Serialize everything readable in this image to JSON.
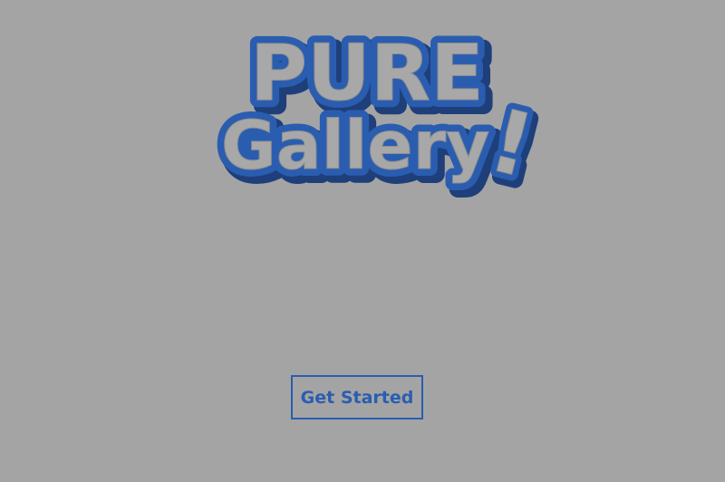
{
  "logo": {
    "line1": "PURE",
    "line2": "Gallery",
    "mark": "!"
  },
  "actions": {
    "get_started_label": "Get Started"
  },
  "colors": {
    "background": "#a4a4a4",
    "accent": "#2a5db0",
    "logo_fill": "#a4a4a4",
    "logo_shadow": "#1e3f7a"
  }
}
